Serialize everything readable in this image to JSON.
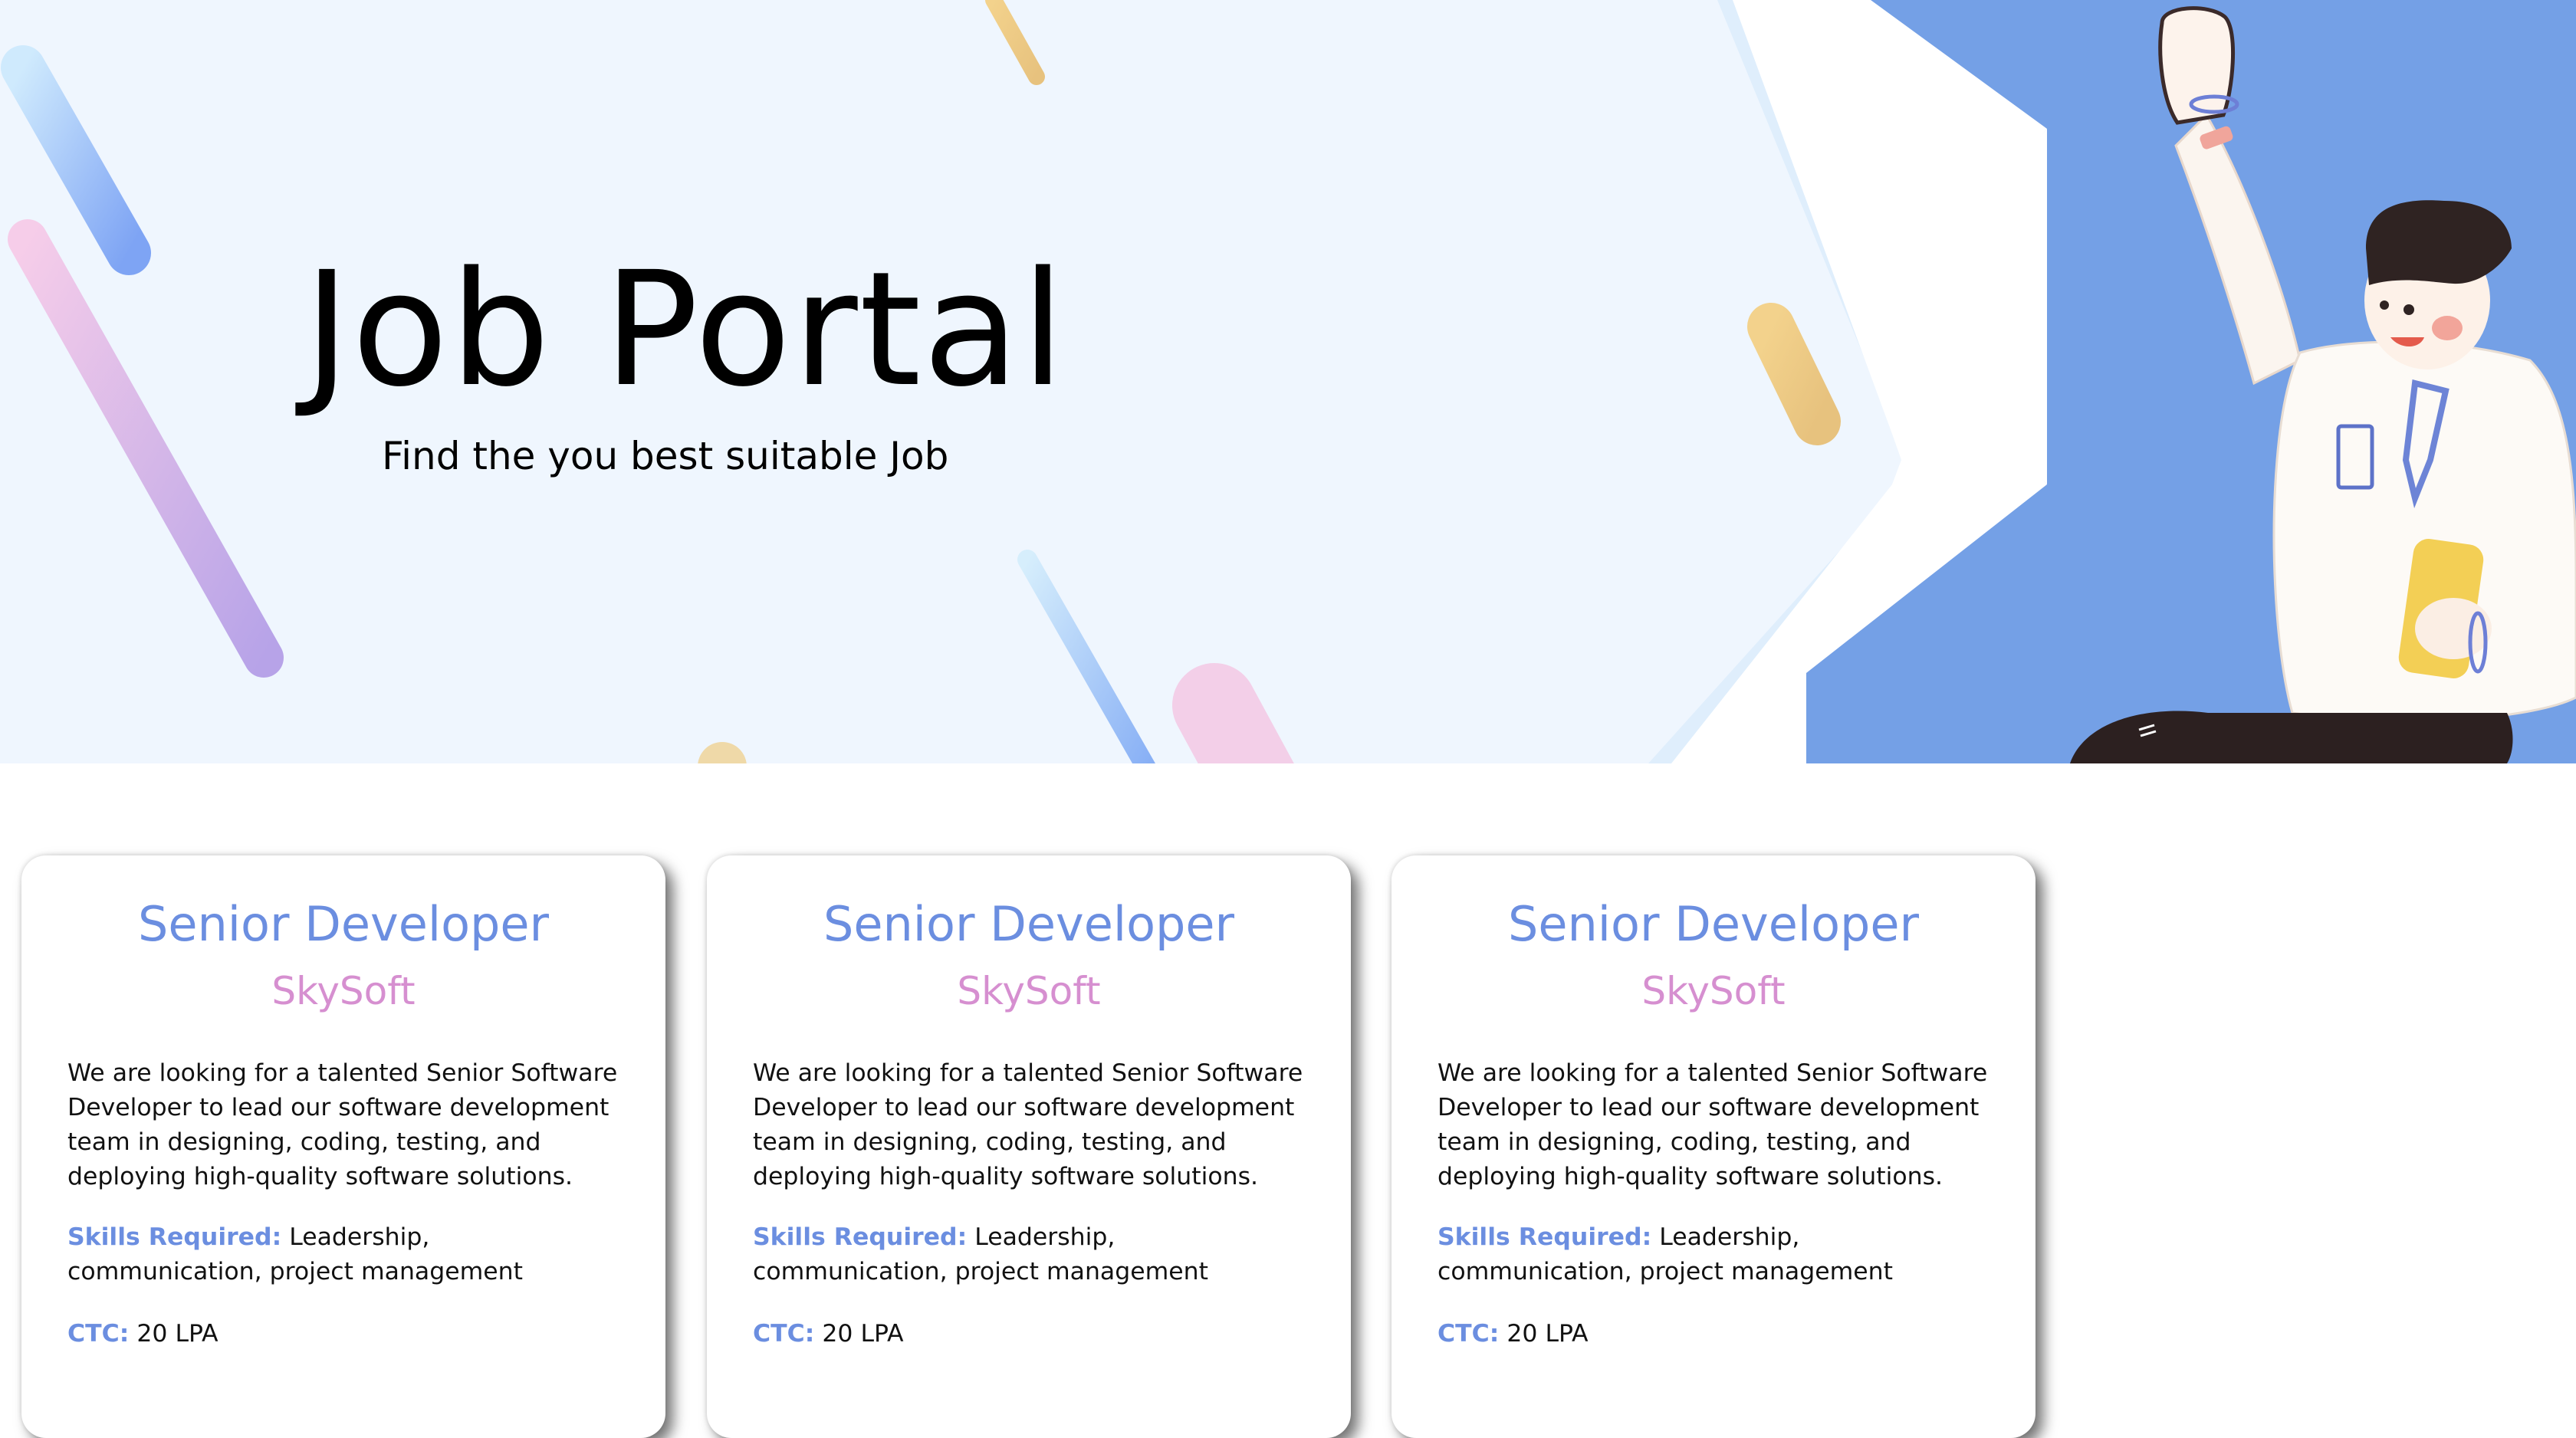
{
  "hero": {
    "title": "Job Portal",
    "subtitle": "Find the you best suitable Job"
  },
  "colors": {
    "hero_background": "#eff6fe",
    "accent_blue": "#6b8ee0",
    "accent_pink": "#d68fd0",
    "panel_blue": "#74a0e6"
  },
  "jobs": [
    {
      "title": "Senior Developer",
      "company": "SkySoft",
      "description": "We are looking for a talented Senior Software Developer to lead our software development team in designing, coding, testing, and deploying high-quality software solutions.",
      "skills_label": "Skills Required:",
      "skills": "Leadership, communication, project management",
      "ctc_label": "CTC:",
      "ctc": "20 LPA"
    },
    {
      "title": "Senior Developer",
      "company": "SkySoft",
      "description": "We are looking for a talented Senior Software Developer to lead our software development team in designing, coding, testing, and deploying high-quality software solutions.",
      "skills_label": "Skills Required:",
      "skills": "Leadership, communication, project management",
      "ctc_label": "CTC:",
      "ctc": "20 LPA"
    },
    {
      "title": "Senior Developer",
      "company": "SkySoft",
      "description": "We are looking for a talented Senior Software Developer to lead our software development team in designing, coding, testing, and deploying high-quality software solutions.",
      "skills_label": "Skills Required:",
      "skills": "Leadership, communication, project management",
      "ctc_label": "CTC:",
      "ctc": "20 LPA"
    }
  ]
}
